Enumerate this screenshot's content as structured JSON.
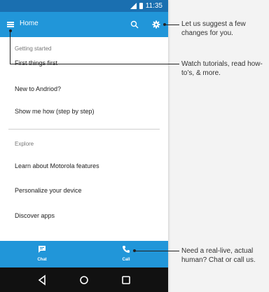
{
  "statusbar": {
    "time": "11:35"
  },
  "appbar": {
    "title": "Home",
    "menu_icon": "menu-icon",
    "search_icon": "search-icon",
    "settings_icon": "gear-icon"
  },
  "sections": {
    "getting_started": "Getting started",
    "explore": "Explore"
  },
  "items": {
    "first_things_first": "First things first",
    "new_to_android": "New to Andriod?",
    "show_me_how": "Show me how (step by step)",
    "learn_motorola": "Learn about Motorola features",
    "personalize": "Personalize your device",
    "discover_apps": "Discover apps"
  },
  "bottom": {
    "chat": "Chat",
    "call": "Call"
  },
  "callouts": {
    "settings": "Let us suggest a few changes for you.",
    "menu": "Watch tutorials, read how-to’s, & more.",
    "call": "Need a real-live, actual human? Chat or call us."
  },
  "colors": {
    "statusbar": "#1a6fb0",
    "appbar": "#2196d9",
    "navbar": "#111111"
  }
}
